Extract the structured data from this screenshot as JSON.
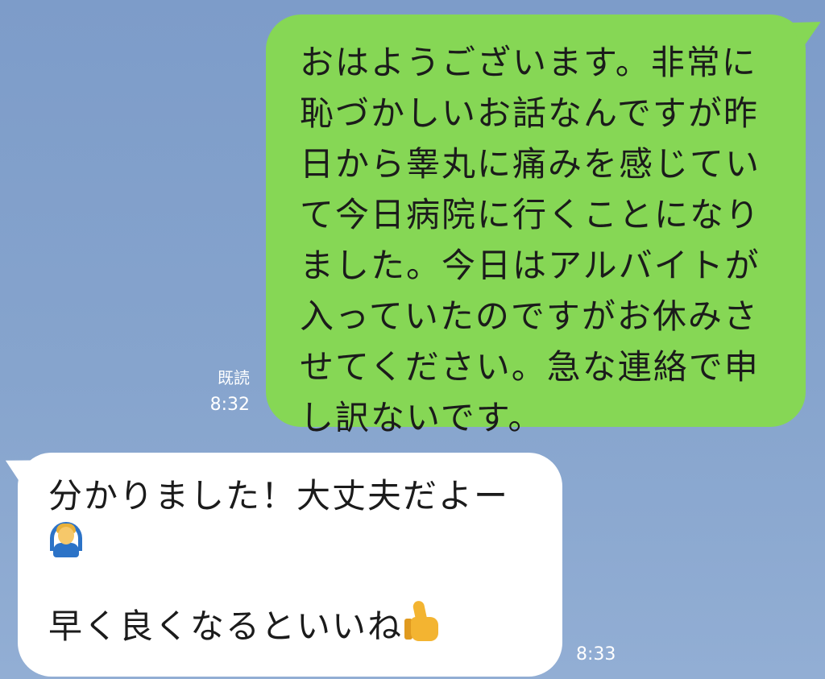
{
  "outgoing": {
    "text": "おはようございます。非常に\n恥づかしいお話なんですが昨\n日から睾丸に痛みを感じてい\nて今日病院に行くことになり\nました。今日はアルバイトが\n入っていたのですがお休みさ\nせてください。急な連絡で申\nし訳ないです。",
    "read_label": "既読",
    "time": "8:32",
    "bubble_color": "#86d755"
  },
  "incoming": {
    "line1": "分かりました！大丈夫だよー",
    "line1_emoji": "person-gesturing-ok-icon",
    "line2": "早く良くなるといいね",
    "line2_emoji": "thumbs-up-icon",
    "time": "8:33",
    "bubble_color": "#ffffff"
  },
  "background_color": "#86a4cd"
}
